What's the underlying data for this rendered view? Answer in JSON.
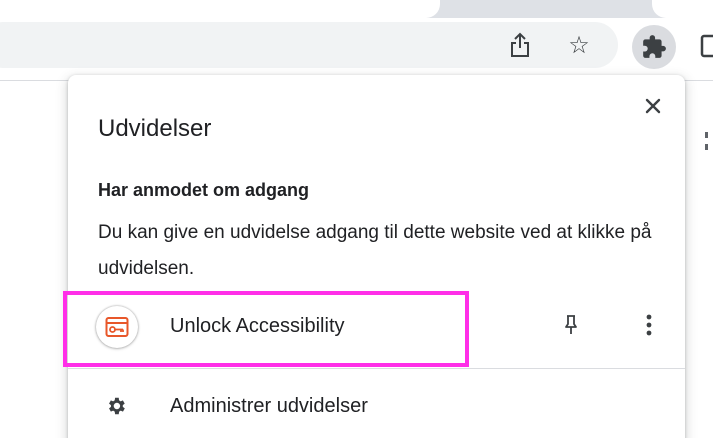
{
  "toolbar": {
    "icons": [
      "share-icon",
      "star-icon",
      "extensions-puzzle-icon",
      "side-panel-icon"
    ],
    "star_glyph": "☆"
  },
  "popup": {
    "title": "Udvidelser",
    "close_glyph": "✕",
    "section_heading": "Har anmodet om adgang",
    "section_description": "Du kan give en udvidelse adgang til dette website ved at klikke på udvidelsen.",
    "extension": {
      "name": "Unlock Accessibility",
      "icon": "unlock-accessibility-logo",
      "highlighted": true,
      "highlight_color": "#ff2ee8"
    },
    "manage_label": "Administrer udvidelser"
  },
  "colors": {
    "text": "#202124",
    "icon": "#5f6368",
    "accent_brand": "#e8572a"
  }
}
